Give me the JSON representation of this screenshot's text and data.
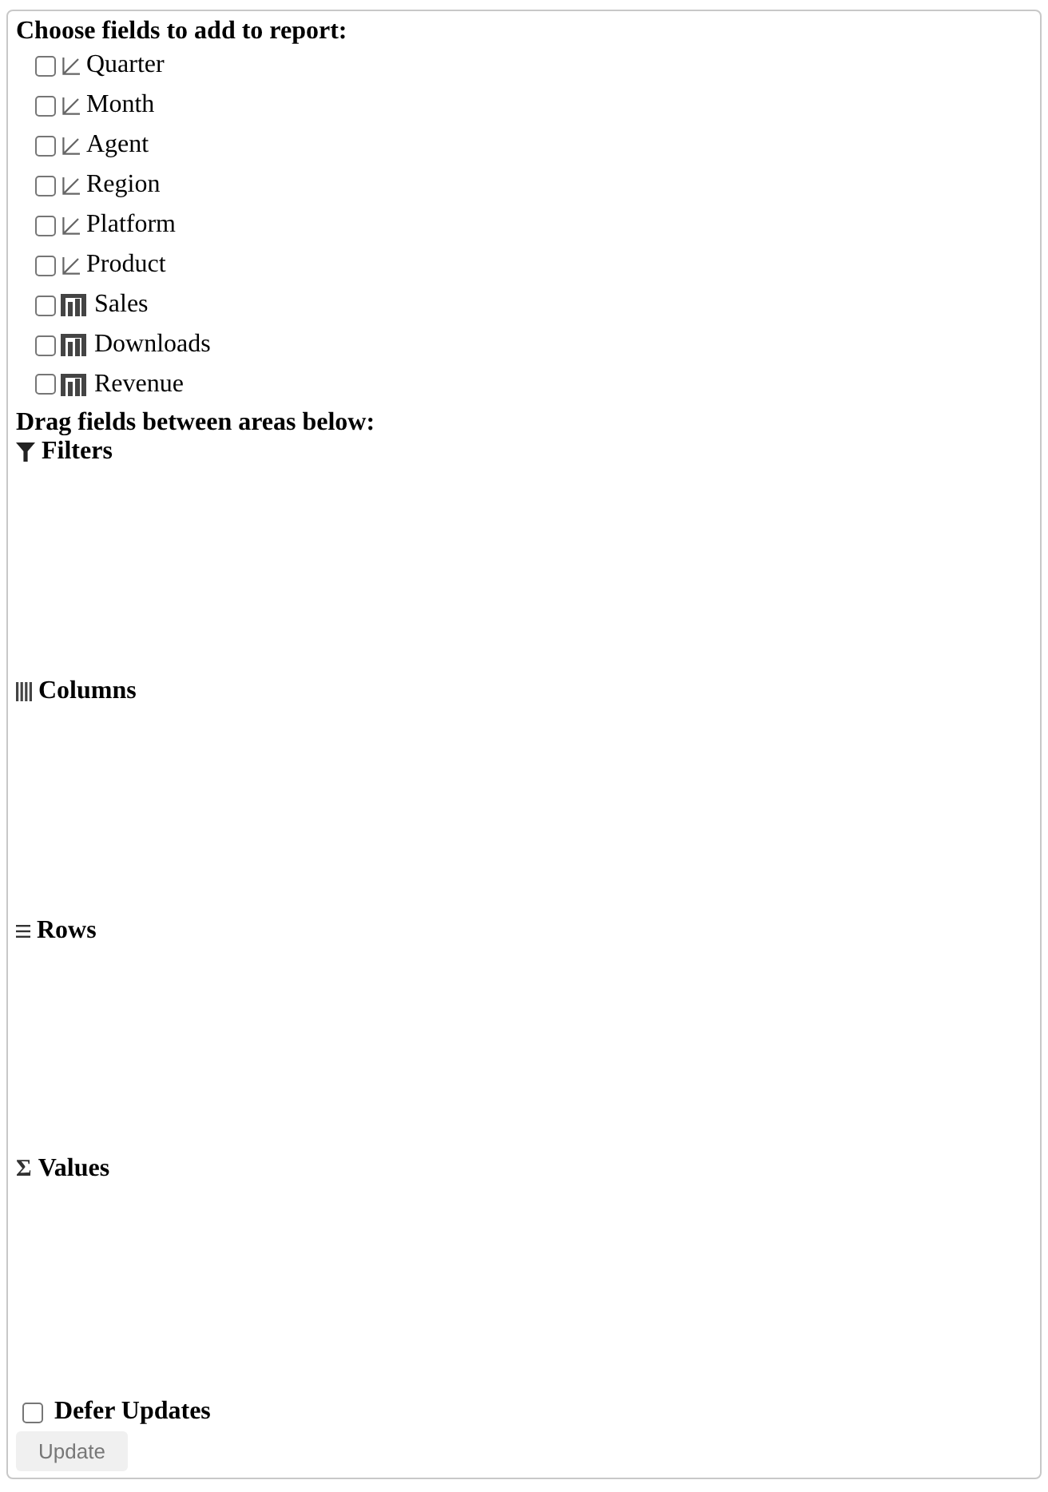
{
  "panel": {
    "title": "Choose fields to add to report:",
    "fields": [
      {
        "name": "Quarter",
        "kind": "dimension",
        "checked": false
      },
      {
        "name": "Month",
        "kind": "dimension",
        "checked": false
      },
      {
        "name": "Agent",
        "kind": "dimension",
        "checked": false
      },
      {
        "name": "Region",
        "kind": "dimension",
        "checked": false
      },
      {
        "name": "Platform",
        "kind": "dimension",
        "checked": false
      },
      {
        "name": "Product",
        "kind": "dimension",
        "checked": false
      },
      {
        "name": "Sales",
        "kind": "measure",
        "checked": false
      },
      {
        "name": "Downloads",
        "kind": "measure",
        "checked": false
      },
      {
        "name": "Revenue",
        "kind": "measure",
        "checked": false
      }
    ],
    "areas_title": "Drag fields between areas below:",
    "areas": [
      {
        "kind": "filters",
        "label": "Filters"
      },
      {
        "kind": "columns",
        "label": "Columns"
      },
      {
        "kind": "rows",
        "label": "Rows"
      },
      {
        "kind": "values",
        "label": "Values",
        "symbol": "Σ"
      }
    ],
    "defer": {
      "label": "Defer Updates",
      "checked": false
    },
    "update_button": {
      "label": "Update",
      "disabled": true
    }
  }
}
